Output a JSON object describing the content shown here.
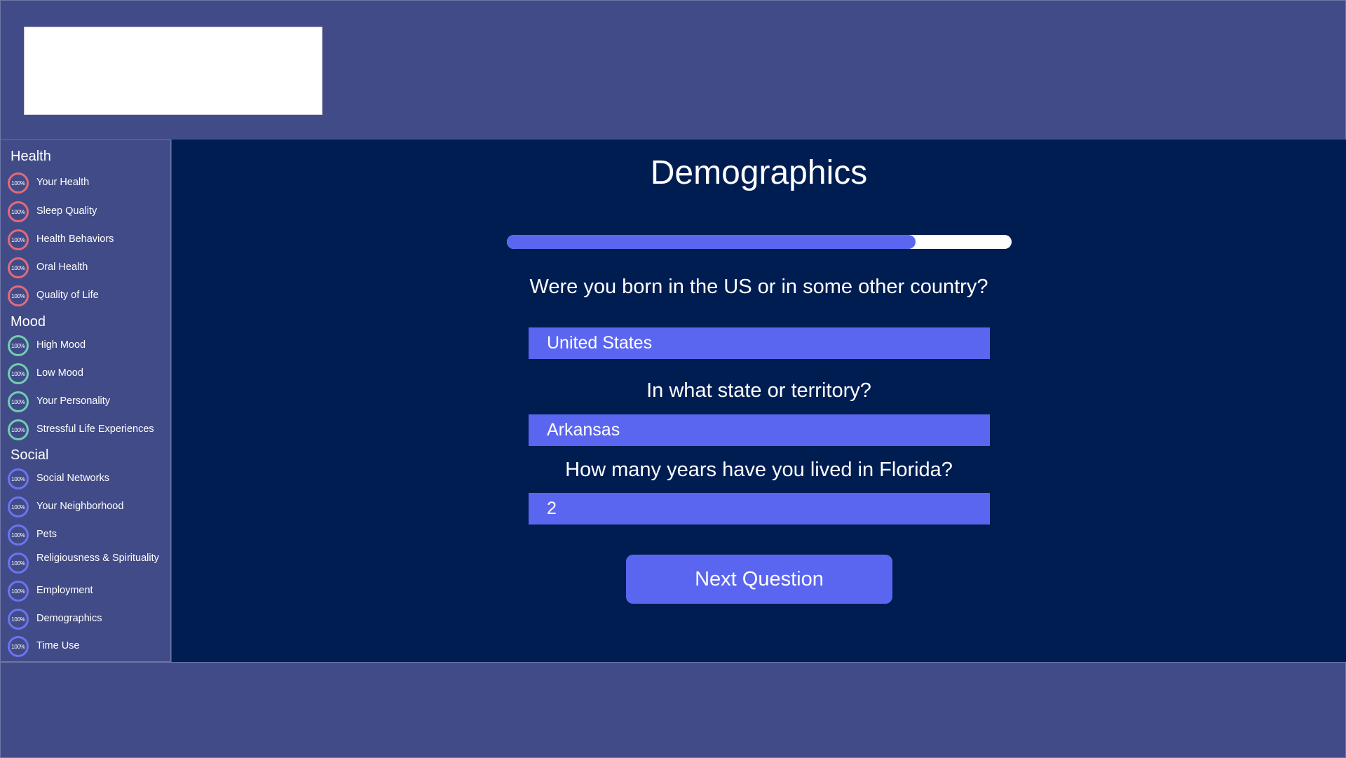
{
  "sidebar": {
    "groups": [
      {
        "title": "Health"
      },
      {
        "title": "Mood"
      },
      {
        "title": "Social"
      }
    ],
    "items": [
      {
        "label": "Your Health",
        "percent": "100%"
      },
      {
        "label": "Sleep Quality",
        "percent": "100%"
      },
      {
        "label": "Health Behaviors",
        "percent": "100%"
      },
      {
        "label": "Oral Health",
        "percent": "100%"
      },
      {
        "label": "Quality of Life",
        "percent": "100%"
      },
      {
        "label": "High Mood",
        "percent": "100%"
      },
      {
        "label": "Low Mood",
        "percent": "100%"
      },
      {
        "label": "Your Personality",
        "percent": "100%"
      },
      {
        "label": "Stressful Life Experiences",
        "percent": "100%"
      },
      {
        "label": "Social Networks",
        "percent": "100%"
      },
      {
        "label": "Your Neighborhood",
        "percent": "100%"
      },
      {
        "label": "Pets",
        "percent": "100%"
      },
      {
        "label": "Religiousness & Spirituality",
        "percent": "100%"
      },
      {
        "label": "Employment",
        "percent": "100%"
      },
      {
        "label": "Demographics",
        "percent": "100%"
      },
      {
        "label": "Time Use",
        "percent": "100%"
      }
    ]
  },
  "main": {
    "title": "Demographics",
    "progress_percent": 81,
    "questions": [
      {
        "text": "Were you born in the US or in some other country?",
        "answer": "United States"
      },
      {
        "text": "In what state or territory?",
        "answer": "Arkansas"
      },
      {
        "text": "How many years have you lived in Florida?",
        "answer": "2"
      }
    ],
    "next_label": "Next Question"
  },
  "colors": {
    "health_ring": "#e46a79",
    "mood_ring": "#6fcfae",
    "social_ring": "#6b74f0",
    "accent": "#5b66f0",
    "main_bg": "#001d52",
    "page_bg": "#414b87"
  }
}
